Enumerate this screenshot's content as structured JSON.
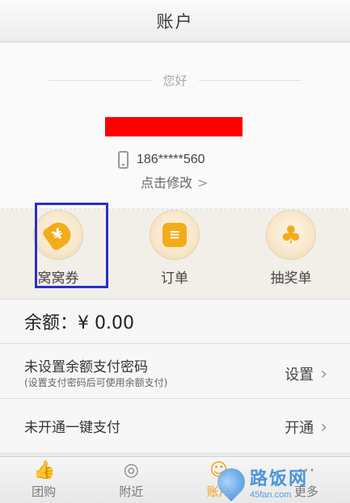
{
  "header": {
    "title": "账户"
  },
  "profile": {
    "greeting": "您好",
    "phone": "186*****560",
    "edit_label": "点击修改",
    "edit_chevron": ">"
  },
  "shortcuts": [
    {
      "label": "窝窝券",
      "icon": "coupon-tag-icon",
      "glyph": "¥"
    },
    {
      "label": "订单",
      "icon": "order-list-icon",
      "glyph": "≡"
    },
    {
      "label": "抽奖单",
      "icon": "clover-icon",
      "glyph": "♣"
    }
  ],
  "balance": {
    "label": "余额：¥ 0.00"
  },
  "rows": {
    "pay_password": {
      "title": "未设置余额支付密码",
      "subtitle": "(设置支付密码后可使用余额支付)",
      "action": "设置"
    },
    "one_click": {
      "title": "未开通一键支付",
      "action": "开通"
    }
  },
  "tabs": [
    {
      "label": "团购",
      "icon": "thumbs-up-icon",
      "glyph": "👍",
      "active": false
    },
    {
      "label": "附近",
      "icon": "location-pin-icon",
      "glyph": "◎",
      "active": false
    },
    {
      "label": "账户",
      "icon": "user-icon",
      "glyph": "☺",
      "active": true
    },
    {
      "label": "更多",
      "icon": "more-icon",
      "glyph": "⋯",
      "active": false
    }
  ],
  "watermark": {
    "title": "路饭网",
    "url": "45fan.com"
  },
  "colors": {
    "accent": "#f2a21a",
    "highlight_box": "#2b2fc7",
    "redaction": "#ff0000"
  }
}
